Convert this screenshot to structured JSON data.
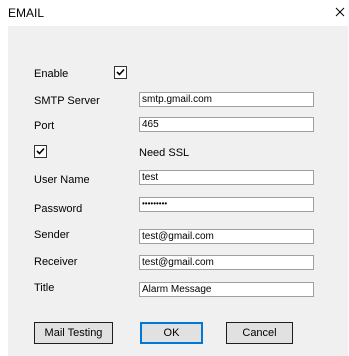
{
  "window": {
    "title": "EMAIL"
  },
  "form": {
    "enable": {
      "label": "Enable",
      "checked": true
    },
    "smtp_server": {
      "label": "SMTP Server",
      "value": "smtp.gmail.com"
    },
    "port": {
      "label": "Port",
      "value": "465"
    },
    "ssl": {
      "label": "Need SSL",
      "checked": true
    },
    "user_name": {
      "label": "User Name",
      "value": "test"
    },
    "password": {
      "label": "Password",
      "value": "•••••••••"
    },
    "sender": {
      "label": "Sender",
      "value": "test@gmail.com"
    },
    "receiver": {
      "label": "Receiver",
      "value": "test@gmail.com"
    },
    "title": {
      "label": "Title",
      "value": "Alarm Message"
    }
  },
  "buttons": {
    "mail_testing": "Mail Testing",
    "ok": "OK",
    "cancel": "Cancel"
  }
}
